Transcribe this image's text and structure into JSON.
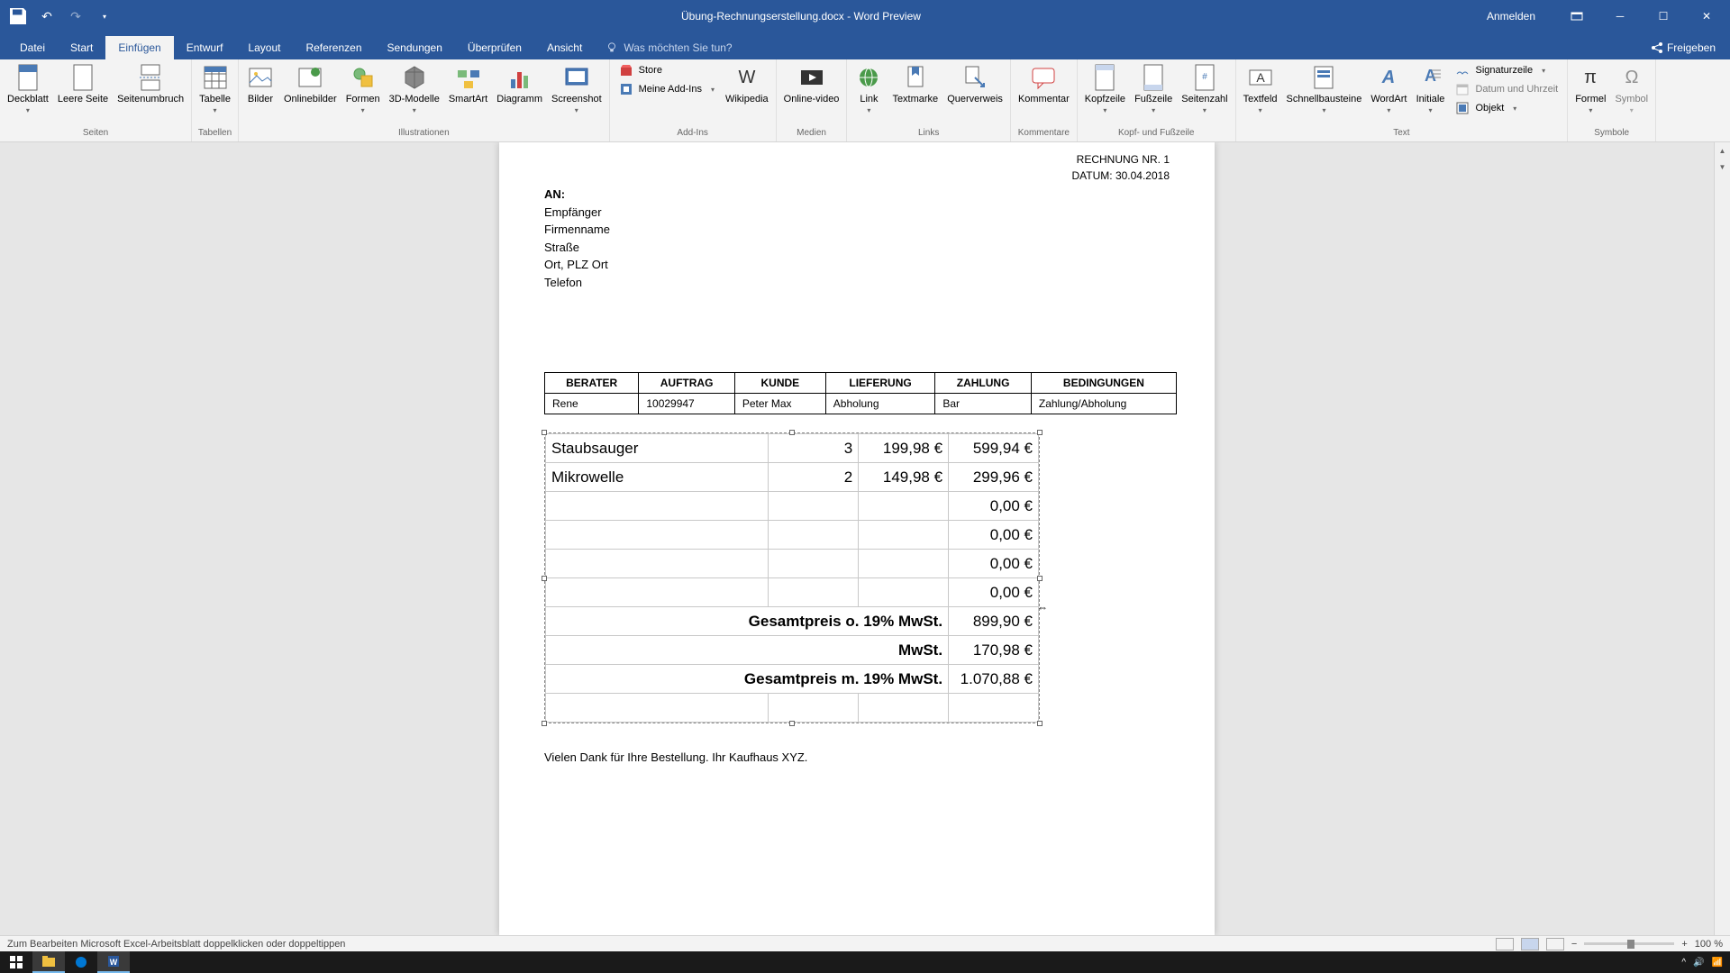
{
  "titlebar": {
    "doc_title": "Übung-Rechnungserstellung.docx - Word Preview",
    "sign_in": "Anmelden"
  },
  "tabs": {
    "datei": "Datei",
    "start": "Start",
    "einfuegen": "Einfügen",
    "entwurf": "Entwurf",
    "layout": "Layout",
    "referenzen": "Referenzen",
    "sendungen": "Sendungen",
    "ueberpruefen": "Überprüfen",
    "ansicht": "Ansicht",
    "tell_me": "Was möchten Sie tun?",
    "freigeben": "Freigeben"
  },
  "ribbon": {
    "deckblatt": "Deckblatt",
    "leere_seite": "Leere Seite",
    "seitenumbruch": "Seitenumbruch",
    "seiten": "Seiten",
    "tabelle": "Tabelle",
    "tabellen": "Tabellen",
    "bilder": "Bilder",
    "onlinebilder": "Onlinebilder",
    "formen": "Formen",
    "smartart": "SmartArt",
    "diagramm": "Diagramm",
    "screenshot": "Screenshot",
    "dmodelle": "3D-Modelle",
    "illustrationen": "Illustrationen",
    "store": "Store",
    "meine_addins": "Meine Add-Ins",
    "wikipedia": "Wikipedia",
    "addins": "Add-Ins",
    "onlinevideo": "Online-video",
    "medien": "Medien",
    "link": "Link",
    "textmarke": "Textmarke",
    "querverweis": "Querverweis",
    "links": "Links",
    "kommentar": "Kommentar",
    "kommentare": "Kommentare",
    "kopfzeile": "Kopfzeile",
    "fusszeile": "Fußzeile",
    "seitenzahl": "Seitenzahl",
    "kopf_fuss": "Kopf- und Fußzeile",
    "textfeld": "Textfeld",
    "schnellbausteine": "Schnellbausteine",
    "wordart": "WordArt",
    "initiale": "Initiale",
    "signaturzeile": "Signaturzeile",
    "datum_uhrzeit": "Datum und Uhrzeit",
    "objekt": "Objekt",
    "text": "Text",
    "formel": "Formel",
    "symbol": "Symbol",
    "symbole": "Symbole"
  },
  "doc": {
    "rechnung_nr": "RECHNUNG NR. 1",
    "datum": "DATUM: 30.04.2018",
    "an": "AN:",
    "empfaenger": "Empfänger",
    "firmenname": "Firmenname",
    "strasse": "Straße",
    "ort_plz": "Ort, PLZ Ort",
    "telefon": "Telefon",
    "headers": {
      "berater": "BERATER",
      "auftrag": "AUFTRAG",
      "kunde": "KUNDE",
      "lieferung": "LIEFERUNG",
      "zahlung": "ZAHLUNG",
      "bedingungen": "BEDINGUNGEN"
    },
    "info_row": {
      "berater": "Rene",
      "auftrag": "10029947",
      "kunde": "Peter Max",
      "lieferung": "Abholung",
      "zahlung": "Bar",
      "bedingungen": "Zahlung/Abholung"
    },
    "line_items": [
      {
        "desc": "Staubsauger",
        "qty": "3",
        "price": "199,98 €",
        "total": "599,94 €"
      },
      {
        "desc": "Mikrowelle",
        "qty": "2",
        "price": "149,98 €",
        "total": "299,96 €"
      },
      {
        "desc": "",
        "qty": "",
        "price": "",
        "total": "0,00 €"
      },
      {
        "desc": "",
        "qty": "",
        "price": "",
        "total": "0,00 €"
      },
      {
        "desc": "",
        "qty": "",
        "price": "",
        "total": "0,00 €"
      },
      {
        "desc": "",
        "qty": "",
        "price": "",
        "total": "0,00 €"
      }
    ],
    "summary": {
      "subtotal_label": "Gesamtpreis o. 19% MwSt.",
      "subtotal_value": "899,90 €",
      "mwst_label": "MwSt.",
      "mwst_value": "170,98 €",
      "total_label": "Gesamtpreis m. 19% MwSt.",
      "total_value": "1.070,88 €"
    },
    "thanks": "Vielen Dank für Ihre Bestellung. Ihr Kaufhaus XYZ."
  },
  "statusbar": {
    "hint": "Zum Bearbeiten Microsoft Excel-Arbeitsblatt doppelklicken oder doppeltippen",
    "zoom": "100 %"
  }
}
